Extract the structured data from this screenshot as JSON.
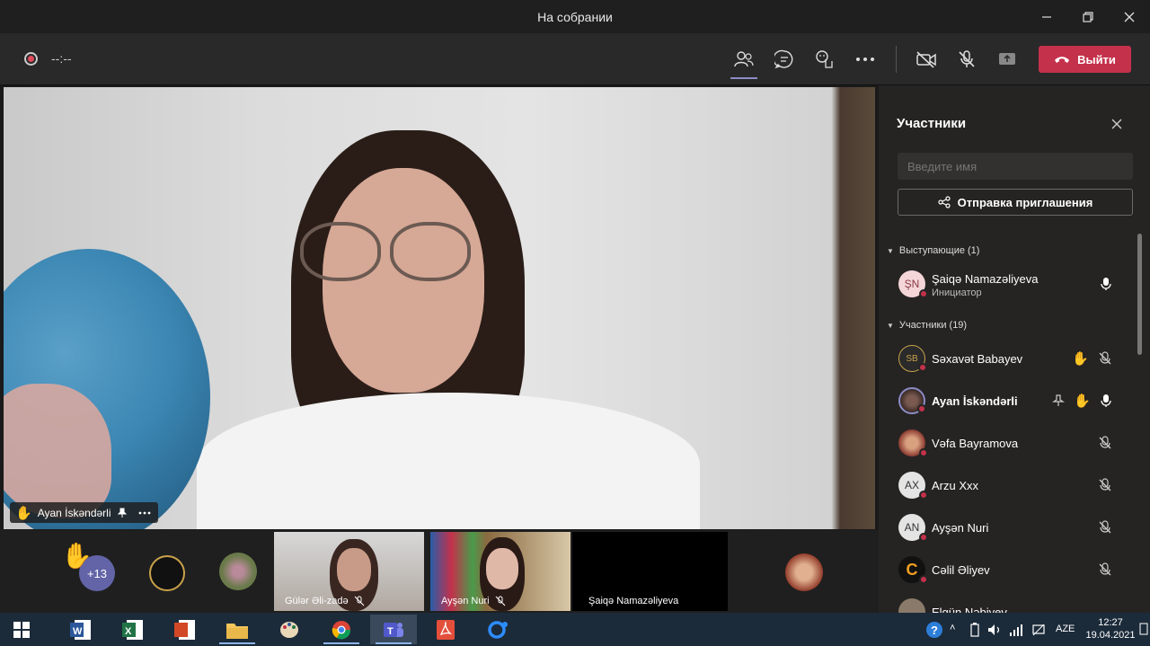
{
  "window": {
    "title": "На собрании"
  },
  "toolbar": {
    "timer": "--:--",
    "leave_label": "Выйти"
  },
  "stage": {
    "pinned_name": "Ayan İskəndərli"
  },
  "participants_panel": {
    "title": "Участники",
    "search_placeholder": "Введите имя",
    "invite_label": "Отправка приглашения",
    "presenters_header": "Выступающие (1)",
    "attendees_header": "Участники (19)",
    "presenters": [
      {
        "initials": "ŞN",
        "name": "Şaiqə Namazəliyeva",
        "role": "Инициатор"
      }
    ],
    "attendees": [
      {
        "initials": "SB",
        "name": "Səxavət Babayev"
      },
      {
        "initials": "",
        "name": "Ayan İskəndərli"
      },
      {
        "initials": "",
        "name": "Vəfa Bayramova"
      },
      {
        "initials": "AX",
        "name": "Arzu Xxx"
      },
      {
        "initials": "AN",
        "name": "Ayşən Nuri"
      },
      {
        "initials": "C",
        "name": "Cəlil Əliyev"
      },
      {
        "initials": "",
        "name": "Elgün Nəbiyev"
      }
    ]
  },
  "filmstrip": {
    "overflow_count": "+13",
    "tiles": [
      {
        "name": "Gülər Əli-zadə"
      },
      {
        "name": "Ayşən Nuri"
      },
      {
        "name": "Şaiqə Namazəliyeva"
      }
    ]
  },
  "taskbar": {
    "language": "AZE",
    "time": "12:27",
    "date": "19.04.2021"
  }
}
